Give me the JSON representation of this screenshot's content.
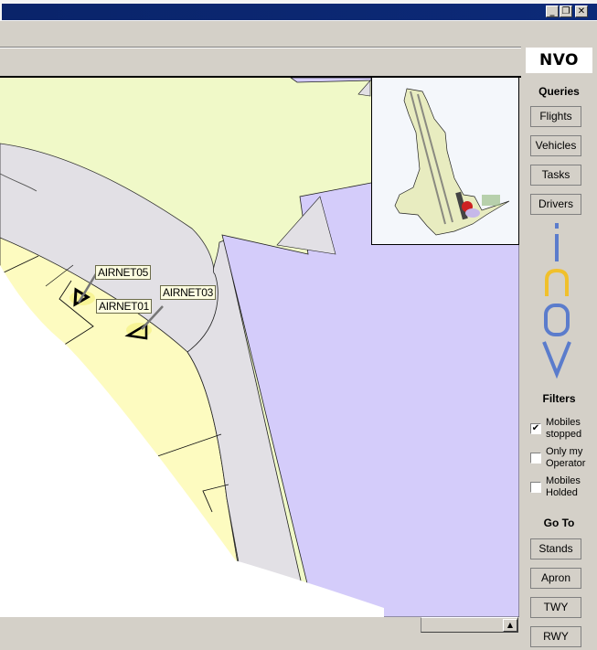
{
  "window": {
    "title": "",
    "controls": {
      "minimize_icon": "_",
      "restore_icon": "❐",
      "close_icon": "✕"
    }
  },
  "brand": {
    "logo_text": "NVO",
    "i2ov_letters": [
      "i",
      "2",
      "O",
      "V"
    ],
    "colors": {
      "blue": "#5b7ccc",
      "yellow": "#f0c02c"
    }
  },
  "sidebar": {
    "queries": {
      "title": "Queries",
      "buttons": [
        {
          "label": "Flights"
        },
        {
          "label": "Vehicles"
        },
        {
          "label": "Tasks"
        },
        {
          "label": "Drivers"
        }
      ]
    },
    "filters": {
      "title": "Filters",
      "items": [
        {
          "label": "Mobiles stopped",
          "checked": true,
          "mark": "✔"
        },
        {
          "label": "Only my Operator",
          "checked": false,
          "mark": ""
        },
        {
          "label": "Mobiles Holded",
          "checked": false,
          "mark": ""
        }
      ]
    },
    "goto": {
      "title": "Go To",
      "buttons": [
        {
          "label": "Stands"
        },
        {
          "label": "Apron"
        },
        {
          "label": "TWY"
        },
        {
          "label": "RWY"
        }
      ]
    }
  },
  "map": {
    "colors": {
      "grass": "#f0f9c8",
      "apron": "#fdfbc0",
      "taxiway": "#e2e0e5",
      "terminal": "#d4ccfa",
      "background": "#ffffff"
    },
    "vehicles": [
      {
        "callsign": "AIRNET05"
      },
      {
        "callsign": "AIRNET03"
      },
      {
        "callsign": "AIRNET01"
      }
    ]
  },
  "scrollbar": {
    "up_arrow": "▲"
  }
}
